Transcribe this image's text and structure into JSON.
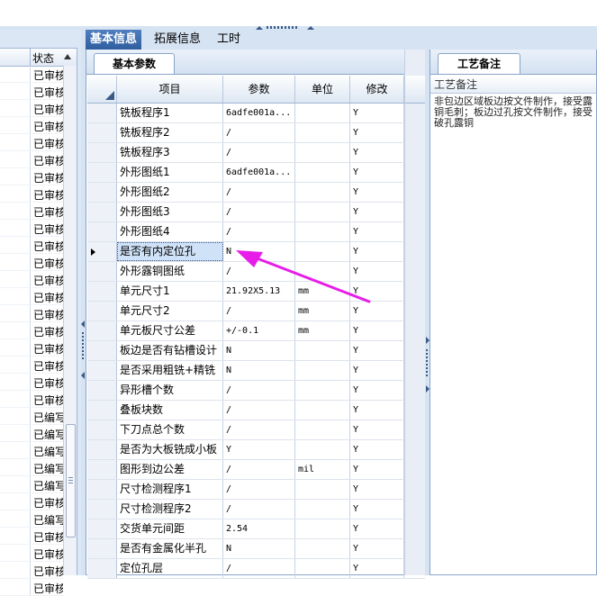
{
  "colors": {
    "accent": "#2f5e9f",
    "panel_bg": "#d6e3f2",
    "arrow": "#e81ce8"
  },
  "left_list": {
    "status_header": "状态",
    "items": [
      "已审核",
      "已审核",
      "已审核",
      "已审核",
      "已审核",
      "已审核",
      "已审核",
      "已审核",
      "已审核",
      "已审核",
      "已审核",
      "已审核",
      "已审核",
      "已审核",
      "已审核",
      "已审核",
      "已审核",
      "已审核",
      "已审核",
      "已审核",
      "已编写",
      "已编写",
      "已编写",
      "已编写",
      "已编写",
      "已审核",
      "已编写",
      "已审核",
      "已审核",
      "已审核",
      "已审核"
    ]
  },
  "main_tabs": [
    "基本信息",
    "拓展信息",
    "工时"
  ],
  "params_panel": {
    "tab_label": "基本参数",
    "columns": [
      "项目",
      "参数",
      "单位",
      "修改"
    ],
    "rows": [
      {
        "name": "铣板程序1",
        "param": "6adfe001a...",
        "unit": "",
        "mod": "Y"
      },
      {
        "name": "铣板程序2",
        "param": "/",
        "unit": "",
        "mod": "Y"
      },
      {
        "name": "铣板程序3",
        "param": "/",
        "unit": "",
        "mod": "Y"
      },
      {
        "name": "外形图纸1",
        "param": "6adfe001a...",
        "unit": "",
        "mod": "Y"
      },
      {
        "name": "外形图纸2",
        "param": "/",
        "unit": "",
        "mod": "Y"
      },
      {
        "name": "外形图纸3",
        "param": "/",
        "unit": "",
        "mod": "Y"
      },
      {
        "name": "外形图纸4",
        "param": "/",
        "unit": "",
        "mod": "Y"
      },
      {
        "name": "是否有内定位孔",
        "param": "N",
        "unit": "",
        "mod": "Y"
      },
      {
        "name": "外形露铜图纸",
        "param": "/",
        "unit": "",
        "mod": "Y"
      },
      {
        "name": "单元尺寸1",
        "param": "21.92X5.13",
        "unit": "mm",
        "mod": "Y"
      },
      {
        "name": "单元尺寸2",
        "param": "/",
        "unit": "mm",
        "mod": "Y"
      },
      {
        "name": "单元板尺寸公差",
        "param": "+/-0.1",
        "unit": "mm",
        "mod": "Y"
      },
      {
        "name": "板边是否有钻槽设计",
        "param": "N",
        "unit": "",
        "mod": "Y"
      },
      {
        "name": "是否采用粗铣+精铣",
        "param": "N",
        "unit": "",
        "mod": "Y"
      },
      {
        "name": "异形槽个数",
        "param": "/",
        "unit": "",
        "mod": "Y"
      },
      {
        "name": "叠板块数",
        "param": "/",
        "unit": "",
        "mod": "Y"
      },
      {
        "name": "下刀点总个数",
        "param": "/",
        "unit": "",
        "mod": "Y"
      },
      {
        "name": "是否为大板铣成小板",
        "param": "Y",
        "unit": "",
        "mod": "Y"
      },
      {
        "name": "图形到边公差",
        "param": "/",
        "unit": "mil",
        "mod": "Y"
      },
      {
        "name": "尺寸检测程序1",
        "param": "/",
        "unit": "",
        "mod": "Y"
      },
      {
        "name": "尺寸检测程序2",
        "param": "/",
        "unit": "",
        "mod": "Y"
      },
      {
        "name": "交货单元间距",
        "param": "2.54",
        "unit": "",
        "mod": "Y"
      },
      {
        "name": "是否有金属化半孔",
        "param": "N",
        "unit": "",
        "mod": "Y"
      },
      {
        "name": "定位孔层",
        "param": "/",
        "unit": "",
        "mod": "Y"
      }
    ]
  },
  "remark_panel": {
    "tab_label": "工艺备注",
    "label": "工艺备注",
    "text": "非包边区域板边按文件制作，接受露铜毛刺；板边过孔按文件制作，接受破孔露铜"
  }
}
